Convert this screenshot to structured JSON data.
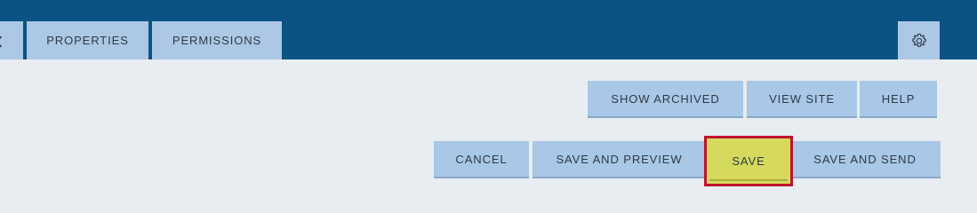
{
  "tabs": {
    "partial_icon": "chevron-left-icon",
    "properties_label": "PROPERTIES",
    "permissions_label": "PERMISSIONS"
  },
  "toolbar": {
    "settings_icon": "gear-icon",
    "show_archived_label": "SHOW ARCHIVED",
    "view_site_label": "VIEW SITE",
    "help_label": "HELP"
  },
  "actions": {
    "cancel_label": "CANCEL",
    "save_preview_label": "SAVE AND PREVIEW",
    "save_label": "SAVE",
    "save_send_label": "SAVE AND SEND"
  },
  "colors": {
    "header_bg": "#0b5384",
    "page_bg": "#e8edf2",
    "button_bg": "#a9c7e6",
    "save_bg": "#d5da5c",
    "highlight_border": "#c0122f"
  }
}
